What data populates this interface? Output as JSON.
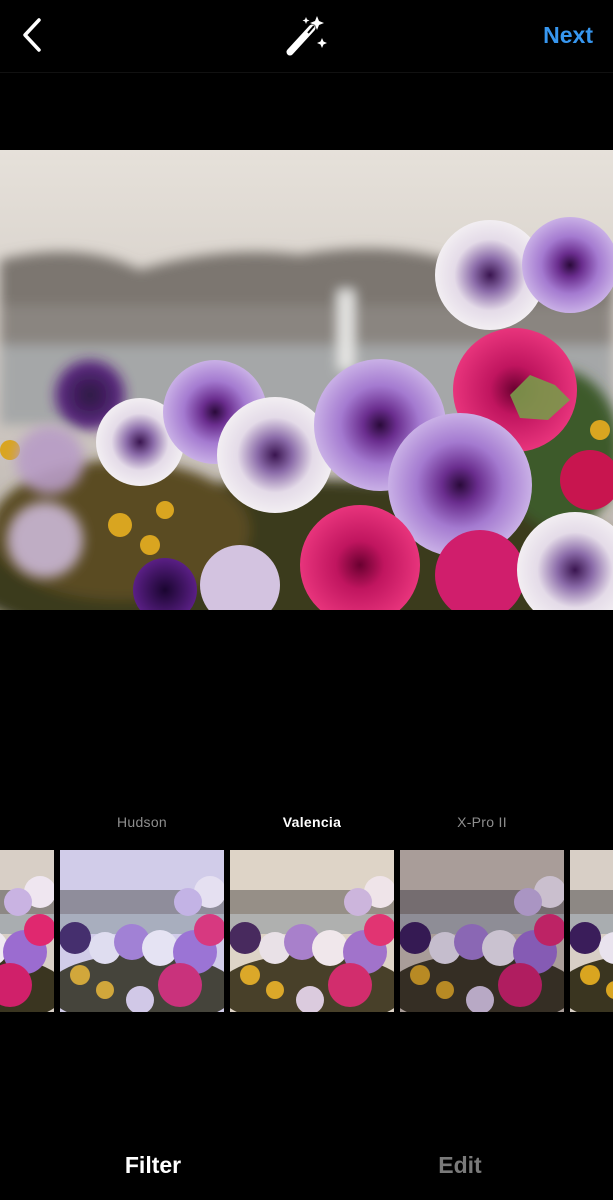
{
  "topbar": {
    "back_icon": "chevron-left-icon",
    "magic_icon": "magic-wand-icon",
    "next_label": "Next",
    "next_color": "#3797f0"
  },
  "filters": [
    {
      "label": ""
    },
    {
      "label": "Hudson"
    },
    {
      "label": "Valencia",
      "selected": true
    },
    {
      "label": "X-Pro II"
    },
    {
      "label": ""
    }
  ],
  "tabs": {
    "filter_label": "Filter",
    "edit_label": "Edit"
  }
}
